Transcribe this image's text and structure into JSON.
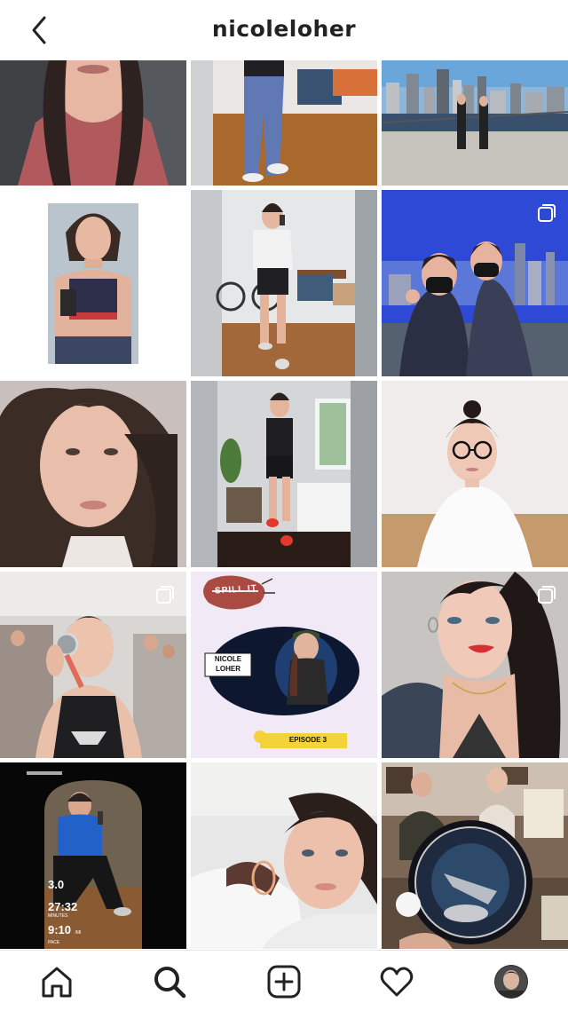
{
  "header": {
    "username": "nicoleloher",
    "back_icon": "chevron-left-icon"
  },
  "posts": [
    {
      "id": "p1",
      "desc": "selfie-braids",
      "multi": false
    },
    {
      "id": "p2",
      "desc": "room-jeans",
      "multi": false
    },
    {
      "id": "p3",
      "desc": "city-skyline-runners",
      "multi": false
    },
    {
      "id": "p4",
      "desc": "sports-bra-selfie",
      "multi": false
    },
    {
      "id": "p5",
      "desc": "mirror-peace-sign",
      "multi": false
    },
    {
      "id": "p6",
      "desc": "masked-friends-skyline",
      "multi": true
    },
    {
      "id": "p7",
      "desc": "close-portrait",
      "multi": false
    },
    {
      "id": "p8",
      "desc": "bedroom-mirror-selfie",
      "multi": false
    },
    {
      "id": "p9",
      "desc": "glasses-portrait",
      "multi": false
    },
    {
      "id": "p10",
      "desc": "medal-race",
      "multi": true
    },
    {
      "id": "p11",
      "desc": "podcast-cover",
      "multi": false
    },
    {
      "id": "p12",
      "desc": "red-lips-portrait",
      "multi": true
    },
    {
      "id": "p13",
      "desc": "run-stats",
      "multi": false
    },
    {
      "id": "p14",
      "desc": "pillow-selfie",
      "multi": false
    },
    {
      "id": "p15",
      "desc": "patch-table",
      "multi": false
    }
  ],
  "podcast": {
    "badge": "SPILL IT",
    "name_line1": "NICOLE",
    "name_line2": "LOHER",
    "episode": "EPISODE 3"
  },
  "run_stats": {
    "distance": "3.0",
    "time": "27:32",
    "time_unit": "MINUTES",
    "pace": "9:10",
    "pace_unit": "/MI",
    "pace_label": "PACE"
  },
  "tabbar": {
    "items": [
      "home-icon",
      "search-icon",
      "add-post-icon",
      "heart-icon",
      "profile-avatar"
    ]
  }
}
